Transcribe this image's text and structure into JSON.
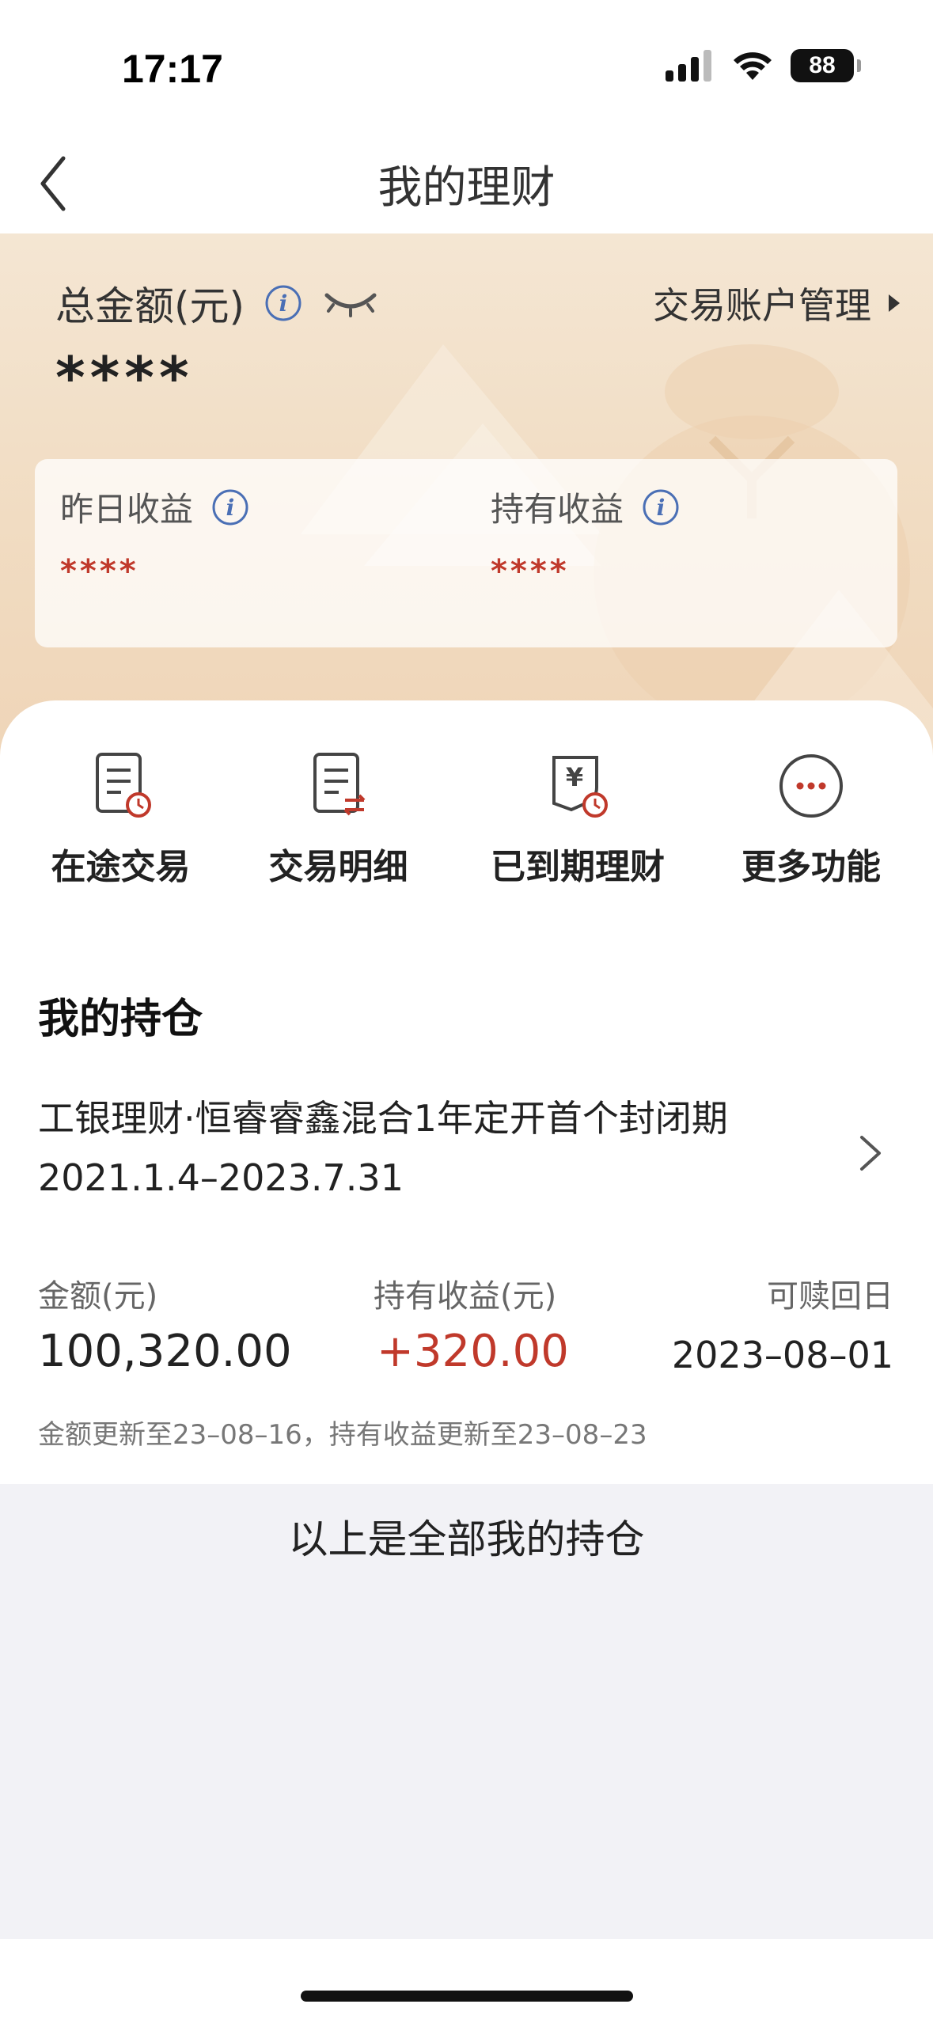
{
  "status_bar": {
    "time": "17:17",
    "battery": "88"
  },
  "nav": {
    "title": "我的理财"
  },
  "summary": {
    "total_label": "总金额(元)",
    "total_value": "****",
    "account_mgmt": "交易账户管理",
    "yesterday_income_label": "昨日收益",
    "yesterday_income_value": "****",
    "holding_income_label": "持有收益",
    "holding_income_value": "****"
  },
  "actions": [
    {
      "label": "在途交易",
      "icon": "document-clock-icon"
    },
    {
      "label": "交易明细",
      "icon": "document-transfer-icon"
    },
    {
      "label": "已到期理财",
      "icon": "yuan-clock-icon"
    },
    {
      "label": "更多功能",
      "icon": "more-dots-icon"
    }
  ],
  "holdings": {
    "title": "我的持仓",
    "product": {
      "name": "工银理财·恒睿睿鑫混合1年定开首个封闭期",
      "period": "2021.1.4–2023.7.31",
      "amount_label": "金额(元)",
      "amount_value": "100,320.00",
      "income_label": "持有收益(元)",
      "income_value": "+320.00",
      "redeem_label": "可赎回日",
      "redeem_value": "2023–08–01",
      "update_note": "金额更新至23–08–16，持有收益更新至23–08–23"
    }
  },
  "footer": {
    "text": "以上是全部我的持仓"
  },
  "colors": {
    "accent_red": "#c0392b",
    "info_blue": "#4a6fb5",
    "gold_bg": "#f1dcc2"
  }
}
